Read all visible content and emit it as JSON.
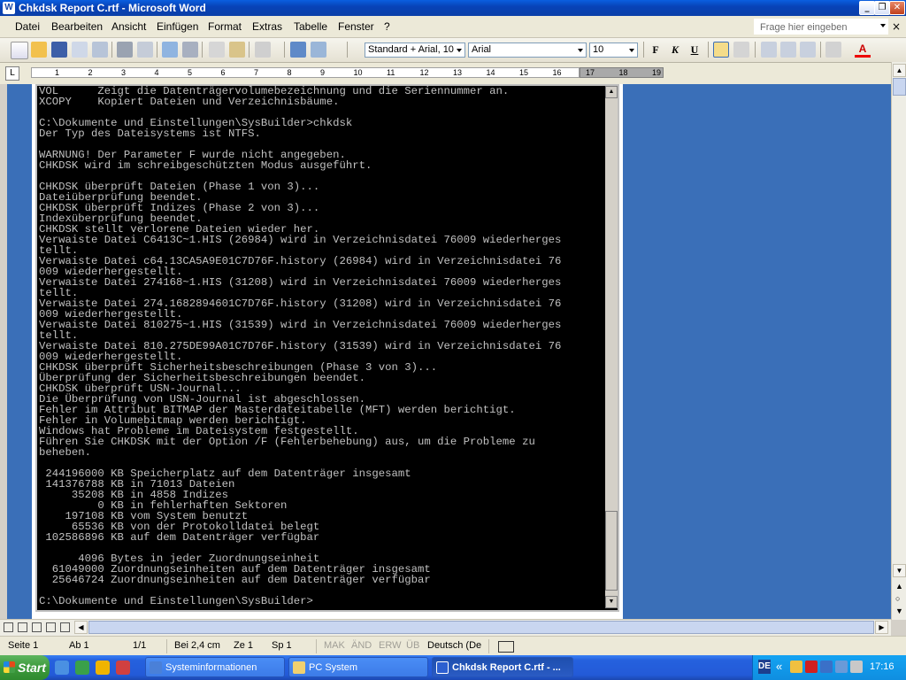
{
  "window": {
    "title": "Chkdsk Report C.rtf - Microsoft Word",
    "app_icon": "W",
    "controls": [
      "minimize-icon",
      "restore-icon",
      "close-icon"
    ]
  },
  "menu": {
    "items": [
      "Datei",
      "Bearbeiten",
      "Ansicht",
      "Einfügen",
      "Format",
      "Extras",
      "Tabelle",
      "Fenster",
      "?"
    ],
    "help_placeholder": "Frage hier eingeben",
    "doc_close": "×"
  },
  "toolbar": {
    "style": "Standard + Arial, 10",
    "font": "Arial",
    "size": "10",
    "bold": "F",
    "italic": "K",
    "underline": "U",
    "font_color_letter": "A"
  },
  "ruler": {
    "ticks": [
      "1",
      "2",
      "3",
      "4",
      "5",
      "6",
      "7",
      "8",
      "9",
      "10",
      "11",
      "12",
      "13",
      "14",
      "15",
      "16",
      "17",
      "18",
      "19"
    ]
  },
  "console": {
    "lines": [
      "VOL      Zeigt die Datenträgervolumebezeichnung und die Seriennummer an.",
      "XCOPY    Kopiert Dateien und Verzeichnisbäume.",
      "",
      "C:\\Dokumente und Einstellungen\\SysBuilder>chkdsk",
      "Der Typ des Dateisystems ist NTFS.",
      "",
      "WARNUNG! Der Parameter F wurde nicht angegeben.",
      "CHKDSK wird im schreibgeschützten Modus ausgeführt.",
      "",
      "CHKDSK überprüft Dateien (Phase 1 von 3)...",
      "Dateiüberprüfung beendet.",
      "CHKDSK überprüft Indizes (Phase 2 von 3)...",
      "Indexüberprüfung beendet.",
      "CHKDSK stellt verlorene Dateien wieder her.",
      "Verwaiste Datei C6413C~1.HIS (26984) wird in Verzeichnisdatei 76009 wiederherges",
      "tellt.",
      "Verwaiste Datei c64.13CA5A9E01C7D76F.history (26984) wird in Verzeichnisdatei 76",
      "009 wiederhergestellt.",
      "Verwaiste Datei 274168~1.HIS (31208) wird in Verzeichnisdatei 76009 wiederherges",
      "tellt.",
      "Verwaiste Datei 274.1682894601C7D76F.history (31208) wird in Verzeichnisdatei 76",
      "009 wiederhergestellt.",
      "Verwaiste Datei 810275~1.HIS (31539) wird in Verzeichnisdatei 76009 wiederherges",
      "tellt.",
      "Verwaiste Datei 810.275DE99A01C7D76F.history (31539) wird in Verzeichnisdatei 76",
      "009 wiederhergestellt.",
      "CHKDSK überprüft Sicherheitsbeschreibungen (Phase 3 von 3)...",
      "Überprüfung der Sicherheitsbeschreibungen beendet.",
      "CHKDSK überprüft USN-Journal...",
      "Die Überprüfung von USN-Journal ist abgeschlossen.",
      "Fehler im Attribut BITMAP der Masterdateitabelle (MFT) werden berichtigt.",
      "Fehler in Volumebitmap werden berichtigt.",
      "Windows hat Probleme im Dateisystem festgestellt.",
      "Führen Sie CHKDSK mit der Option /F (Fehlerbehebung) aus, um die Probleme zu",
      "beheben.",
      "",
      " 244196000 KB Speicherplatz auf dem Datenträger insgesamt",
      " 141376788 KB in 71013 Dateien",
      "     35208 KB in 4858 Indizes",
      "         0 KB in fehlerhaften Sektoren",
      "    197108 KB vom System benutzt",
      "     65536 KB von der Protokolldatei belegt",
      " 102586896 KB auf dem Datenträger verfügbar",
      "",
      "      4096 Bytes in jeder Zuordnungseinheit",
      "  61049000 Zuordnungseinheiten auf dem Datenträger insgesamt",
      "  25646724 Zuordnungseinheiten auf dem Datenträger verfügbar",
      "",
      "C:\\Dokumente und Einstellungen\\SysBuilder>"
    ]
  },
  "status": {
    "page": "Seite 1",
    "section": "Ab 1",
    "pages": "1/1",
    "at": "Bei 2,4 cm",
    "line": "Ze 1",
    "col": "Sp 1",
    "mak": "MAK",
    "aend": "ÄND",
    "erw": "ERW",
    "ueb": "ÜB",
    "lang": "Deutsch (De"
  },
  "taskbar": {
    "start": "Start",
    "tasks": [
      {
        "label": "Systeminformationen",
        "active": false
      },
      {
        "label": "PC System",
        "active": false
      },
      {
        "label": "Chkdsk Report C.rtf - ...",
        "active": true
      }
    ],
    "lang_indicator": "DE",
    "tray_chevron": "«",
    "clock": "17:16"
  },
  "colors": {
    "console_bg": "#000000",
    "console_fg": "#c0c0c0",
    "doc_background": "#3a6fb8",
    "title_blue": "#0a5fe0"
  }
}
